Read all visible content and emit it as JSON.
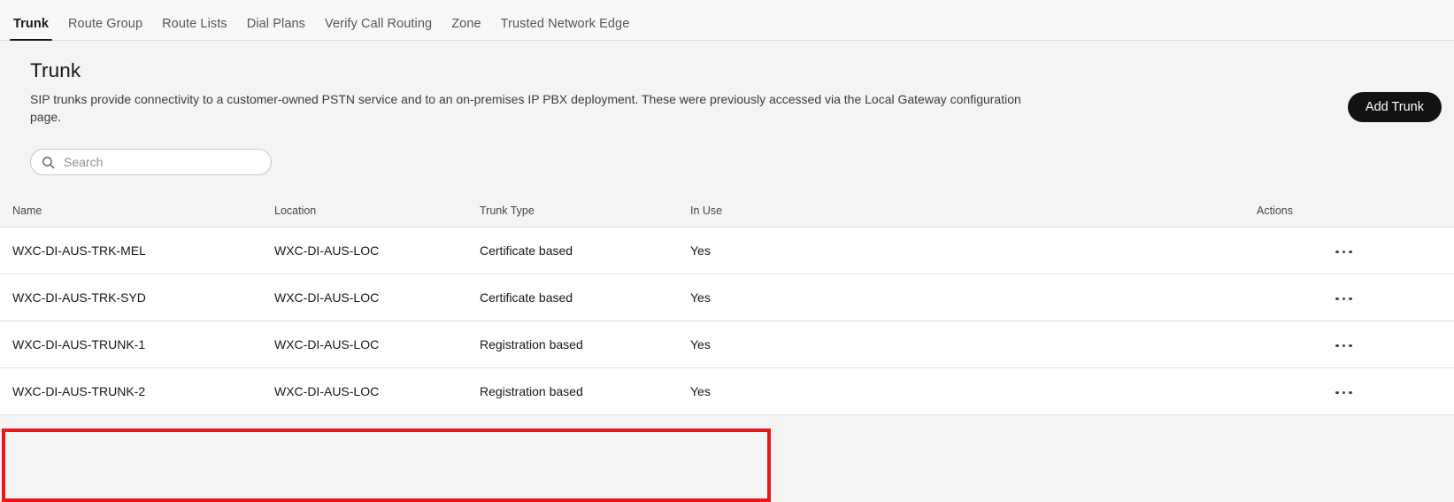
{
  "tabs": [
    {
      "label": "Trunk",
      "active": true
    },
    {
      "label": "Route Group",
      "active": false
    },
    {
      "label": "Route Lists",
      "active": false
    },
    {
      "label": "Dial Plans",
      "active": false
    },
    {
      "label": "Verify Call Routing",
      "active": false
    },
    {
      "label": "Zone",
      "active": false
    },
    {
      "label": "Trusted Network Edge",
      "active": false
    }
  ],
  "header": {
    "title": "Trunk",
    "description": "SIP trunks provide connectivity to a customer-owned PSTN service and to an on-premises IP PBX deployment. These were previously accessed via the Local Gateway configuration page.",
    "add_button_label": "Add Trunk"
  },
  "search": {
    "placeholder": "Search",
    "value": "",
    "icon": "search-icon"
  },
  "table": {
    "columns": [
      "Name",
      "Location",
      "Trunk Type",
      "In Use",
      "Actions"
    ],
    "rows": [
      {
        "name": "WXC-DI-AUS-TRK-MEL",
        "location": "WXC-DI-AUS-LOC",
        "trunk_type": "Certificate based",
        "in_use": "Yes",
        "action_icon": "ellipsis-icon"
      },
      {
        "name": "WXC-DI-AUS-TRK-SYD",
        "location": "WXC-DI-AUS-LOC",
        "trunk_type": "Certificate based",
        "in_use": "Yes",
        "action_icon": "ellipsis-icon"
      },
      {
        "name": "WXC-DI-AUS-TRUNK-1",
        "location": "WXC-DI-AUS-LOC",
        "trunk_type": "Registration based",
        "in_use": "Yes",
        "action_icon": "ellipsis-icon"
      },
      {
        "name": "WXC-DI-AUS-TRUNK-2",
        "location": "WXC-DI-AUS-LOC",
        "trunk_type": "Registration based",
        "in_use": "Yes",
        "action_icon": "ellipsis-icon"
      }
    ]
  },
  "annotation": {
    "color": "#e8191b",
    "highlights_rows": [
      "WXC-DI-AUS-TRK-MEL",
      "WXC-DI-AUS-TRK-SYD"
    ]
  },
  "colors": {
    "page_background": "#f4f4f5",
    "tabbar_background": "#f8f8f8",
    "row_background": "#ffffff",
    "accent_dark": "#121214",
    "annotation_red": "#e8191b",
    "text_primary": "#16161a",
    "text_secondary": "#46474b"
  }
}
